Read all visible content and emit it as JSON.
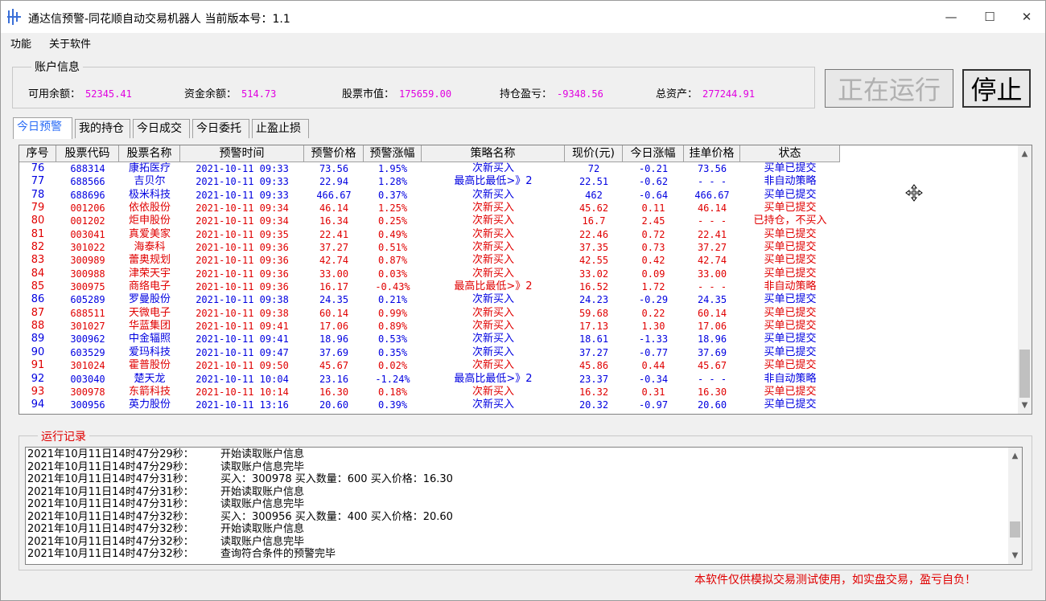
{
  "window": {
    "title": "通达信预警-同花顺自动交易机器人   当前版本号：1.1",
    "minimize": "—",
    "maximize": "☐",
    "close": "✕"
  },
  "menu": {
    "items": [
      "功能",
      "关于软件"
    ]
  },
  "account": {
    "group_title": "账户信息",
    "fields": [
      {
        "label": "可用余额：",
        "value": "52345.41"
      },
      {
        "label": "资金余额：",
        "value": "514.73"
      },
      {
        "label": "股票市值：",
        "value": "175659.00"
      },
      {
        "label": "持仓盈亏：",
        "value": "-9348.56"
      },
      {
        "label": "总资产：",
        "value": "277244.91"
      }
    ],
    "value_color": "#e000e0"
  },
  "controls": {
    "running_label": "正在运行",
    "stop_label": "停止"
  },
  "tabs": [
    "今日预警",
    "我的持仓",
    "今日成交",
    "今日委托",
    "止盈止损"
  ],
  "active_tab": 0,
  "grid": {
    "columns": [
      "序号",
      "股票代码",
      "股票名称",
      "预警时间",
      "预警价格",
      "预警涨幅",
      "策略名称",
      "现价(元)",
      "今日涨幅",
      "挂单价格",
      "状态"
    ],
    "rows": [
      {
        "color": "blue",
        "cells": [
          "76",
          "688314",
          "康拓医疗",
          "2021-10-11 09:33",
          "73.56",
          "1.95%",
          "次新买入",
          "72",
          "-0.21",
          "73.56",
          "买单已提交"
        ]
      },
      {
        "color": "blue",
        "cells": [
          "77",
          "688566",
          "吉贝尔",
          "2021-10-11 09:33",
          "22.94",
          "1.28%",
          "最高比最低>》2",
          "22.51",
          "-0.62",
          "- - -",
          "非自动策略"
        ]
      },
      {
        "color": "blue",
        "cells": [
          "78",
          "688696",
          "极米科技",
          "2021-10-11 09:33",
          "466.67",
          "0.37%",
          "次新买入",
          "462",
          "-0.64",
          "466.67",
          "买单已提交"
        ]
      },
      {
        "color": "red",
        "cells": [
          "79",
          "001206",
          "依依股份",
          "2021-10-11 09:34",
          "46.14",
          "1.25%",
          "次新买入",
          "45.62",
          "0.11",
          "46.14",
          "买单已提交"
        ]
      },
      {
        "color": "red",
        "cells": [
          "80",
          "001202",
          "炬申股份",
          "2021-10-11 09:34",
          "16.34",
          "0.25%",
          "次新买入",
          "16.7",
          "2.45",
          "- - -",
          "已持仓，不买入"
        ]
      },
      {
        "color": "red",
        "cells": [
          "81",
          "003041",
          "真爱美家",
          "2021-10-11 09:35",
          "22.41",
          "0.49%",
          "次新买入",
          "22.46",
          "0.72",
          "22.41",
          "买单已提交"
        ]
      },
      {
        "color": "red",
        "cells": [
          "82",
          "301022",
          "海泰科",
          "2021-10-11 09:36",
          "37.27",
          "0.51%",
          "次新买入",
          "37.35",
          "0.73",
          "37.27",
          "买单已提交"
        ]
      },
      {
        "color": "red",
        "cells": [
          "83",
          "300989",
          "蕾奥规划",
          "2021-10-11 09:36",
          "42.74",
          "0.87%",
          "次新买入",
          "42.55",
          "0.42",
          "42.74",
          "买单已提交"
        ]
      },
      {
        "color": "red",
        "cells": [
          "84",
          "300988",
          "津荣天宇",
          "2021-10-11 09:36",
          "33.00",
          "0.03%",
          "次新买入",
          "33.02",
          "0.09",
          "33.00",
          "买单已提交"
        ]
      },
      {
        "color": "red",
        "cells": [
          "85",
          "300975",
          "商络电子",
          "2021-10-11 09:36",
          "16.17",
          "-0.43%",
          "最高比最低>》2",
          "16.52",
          "1.72",
          "- - -",
          "非自动策略"
        ]
      },
      {
        "color": "blue",
        "cells": [
          "86",
          "605289",
          "罗曼股份",
          "2021-10-11 09:38",
          "24.35",
          "0.21%",
          "次新买入",
          "24.23",
          "-0.29",
          "24.35",
          "买单已提交"
        ]
      },
      {
        "color": "red",
        "cells": [
          "87",
          "688511",
          "天微电子",
          "2021-10-11 09:38",
          "60.14",
          "0.99%",
          "次新买入",
          "59.68",
          "0.22",
          "60.14",
          "买单已提交"
        ]
      },
      {
        "color": "red",
        "cells": [
          "88",
          "301027",
          "华蓝集团",
          "2021-10-11 09:41",
          "17.06",
          "0.89%",
          "次新买入",
          "17.13",
          "1.30",
          "17.06",
          "买单已提交"
        ]
      },
      {
        "color": "blue",
        "cells": [
          "89",
          "300962",
          "中金辐照",
          "2021-10-11 09:41",
          "18.96",
          "0.53%",
          "次新买入",
          "18.61",
          "-1.33",
          "18.96",
          "买单已提交"
        ]
      },
      {
        "color": "blue",
        "cells": [
          "90",
          "603529",
          "爱玛科技",
          "2021-10-11 09:47",
          "37.69",
          "0.35%",
          "次新买入",
          "37.27",
          "-0.77",
          "37.69",
          "买单已提交"
        ]
      },
      {
        "color": "red",
        "cells": [
          "91",
          "301024",
          "霍普股份",
          "2021-10-11 09:50",
          "45.67",
          "0.02%",
          "次新买入",
          "45.86",
          "0.44",
          "45.67",
          "买单已提交"
        ]
      },
      {
        "color": "blue",
        "cells": [
          "92",
          "003040",
          "楚天龙",
          "2021-10-11 10:04",
          "23.16",
          "-1.24%",
          "最高比最低>》2",
          "23.37",
          "-0.34",
          "- - -",
          "非自动策略"
        ]
      },
      {
        "color": "red",
        "cells": [
          "93",
          "300978",
          "东箭科技",
          "2021-10-11 10:14",
          "16.30",
          "0.18%",
          "次新买入",
          "16.32",
          "0.31",
          "16.30",
          "买单已提交"
        ]
      },
      {
        "color": "blue",
        "cells": [
          "94",
          "300956",
          "英力股份",
          "2021-10-11 13:16",
          "20.60",
          "0.39%",
          "次新买入",
          "20.32",
          "-0.97",
          "20.60",
          "买单已提交"
        ]
      }
    ]
  },
  "log": {
    "group_title": "运行记录",
    "lines": [
      {
        "time": "2021年10月11日14时47分29秒：",
        "msg": "开始读取账户信息"
      },
      {
        "time": "2021年10月11日14时47分29秒：",
        "msg": "读取账户信息完毕"
      },
      {
        "time": "2021年10月11日14时47分31秒：",
        "msg": "买入：300978  买入数量：600  买入价格：16.30"
      },
      {
        "time": "2021年10月11日14时47分31秒：",
        "msg": "开始读取账户信息"
      },
      {
        "time": "2021年10月11日14时47分31秒：",
        "msg": "读取账户信息完毕"
      },
      {
        "time": "2021年10月11日14时47分32秒：",
        "msg": "买入：300956  买入数量：400  买入价格：20.60"
      },
      {
        "time": "2021年10月11日14时47分32秒：",
        "msg": "开始读取账户信息"
      },
      {
        "time": "2021年10月11日14时47分32秒：",
        "msg": "读取账户信息完毕"
      },
      {
        "time": "2021年10月11日14时47分32秒：",
        "msg": "查询符合条件的预警完毕"
      }
    ]
  },
  "footer": {
    "disclaimer": "本软件仅供模拟交易测试使用，如实盘交易，盈亏自负！"
  },
  "colors": {
    "red": "#e00000",
    "blue": "#0000e0",
    "accent_tab": "#2a6cf6"
  }
}
